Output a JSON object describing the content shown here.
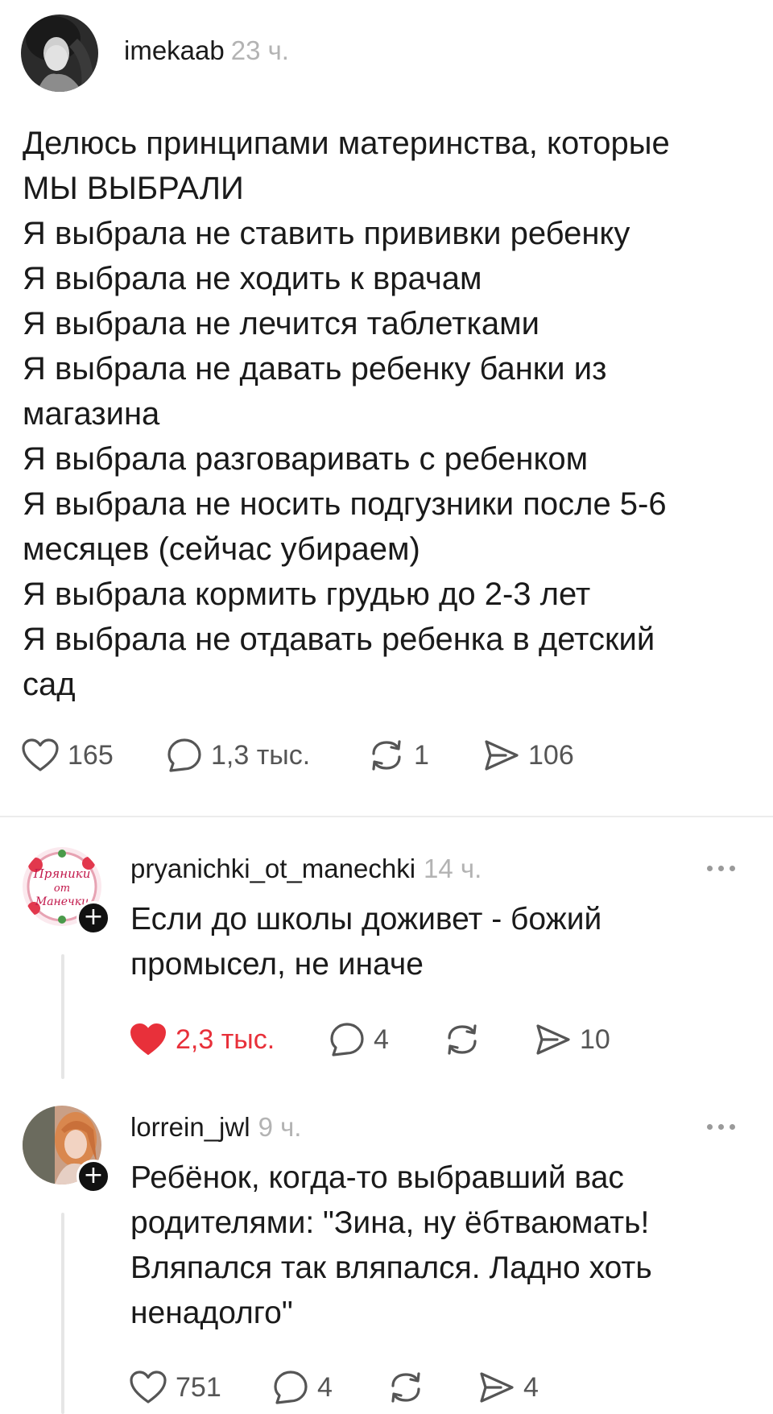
{
  "post": {
    "username": "imekaab",
    "time": "23 ч.",
    "lines": [
      "Делюсь принципами материнства, которые",
      "МЫ ВЫБРАЛИ",
      "Я выбрала не ставить прививки ребенку",
      "Я выбрала не ходить к врачам",
      "Я выбрала не лечится таблетками",
      "Я выбрала не давать ребенку банки из",
      "магазина",
      "Я выбрала разговаривать с ребенком",
      "Я выбрала не носить подгузники после 5-6",
      "месяцев (сейчас убираем)",
      "Я выбрала кормить грудью до 2-3 лет",
      "Я выбрала не отдавать ребенка в детский",
      "сад"
    ],
    "likes": "165",
    "comments": "1,3 тыс.",
    "reposts": "1",
    "shares": "106"
  },
  "comments": [
    {
      "username": "pryanichki_ot_manechki",
      "time": "14 ч.",
      "lines": [
        "Если до школы доживет - божий",
        "промысел, не иначе"
      ],
      "likes": "2,3 тыс.",
      "liked": true,
      "replies": "4",
      "reposts": "",
      "shares": "10",
      "avatar_text": [
        "Пряники",
        "от",
        "Манечки"
      ]
    },
    {
      "username": "lorrein_jwl",
      "time": "9 ч.",
      "lines": [
        "Ребёнок, когда-то выбравший вас",
        "родителями: \"Зина, ну ёбтваюмать!",
        "Вляпался так вляпался. Ладно хоть",
        "ненадолго\""
      ],
      "likes": "751",
      "liked": false,
      "replies": "4",
      "reposts": "",
      "shares": "4"
    }
  ],
  "colors": {
    "like_active": "#e8303a",
    "muted": "#b3b3b3",
    "icon": "#555555"
  }
}
